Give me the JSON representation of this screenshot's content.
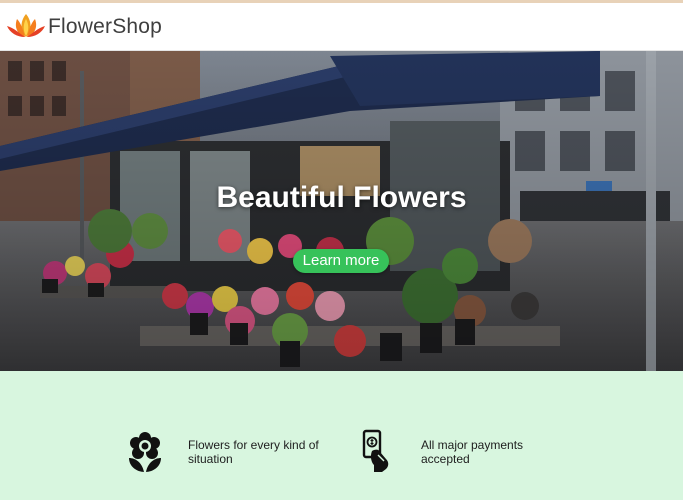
{
  "header": {
    "brand": "FlowerShop",
    "logo_icon": "lotus-logo-icon"
  },
  "hero": {
    "title": "Beautiful Flowers",
    "button_label": "Learn more",
    "button_color": "#37c25a"
  },
  "features": [
    {
      "icon": "flower-icon",
      "line1": "Flowers for every kind of",
      "line2": "situation"
    },
    {
      "icon": "mobile-payment-icon",
      "line1": "All major payments",
      "line2": "accepted"
    }
  ],
  "colors": {
    "features_background": "#d8f6df",
    "brand_text": "#3f3f3f"
  }
}
